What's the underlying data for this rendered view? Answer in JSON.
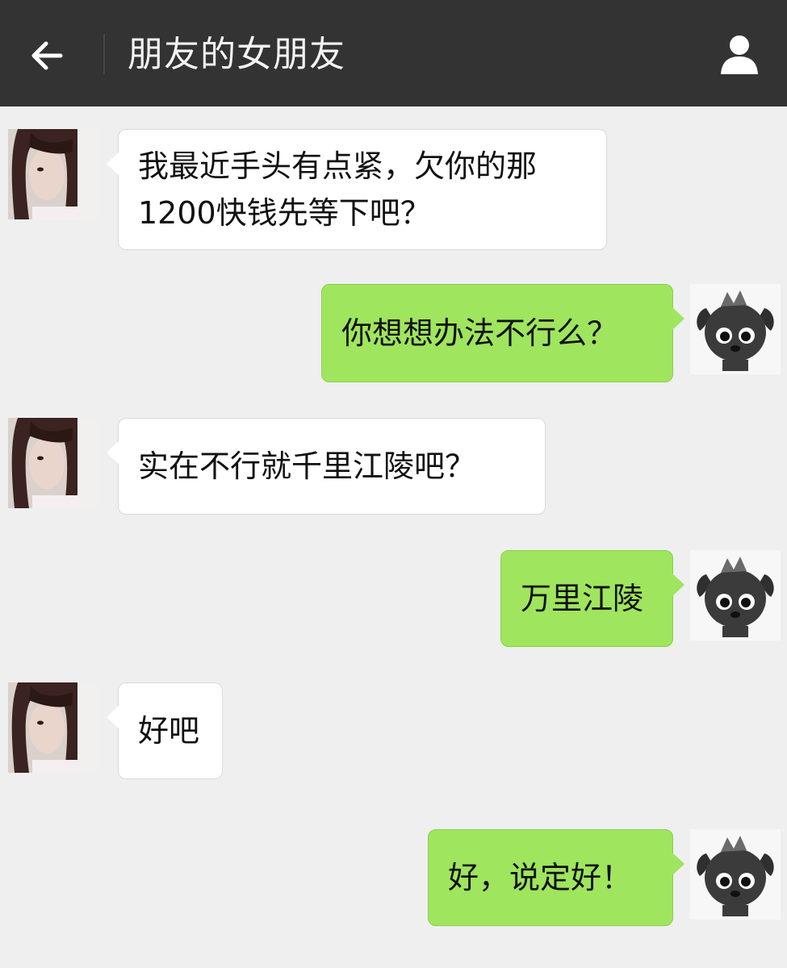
{
  "header": {
    "title": "朋友的女朋友",
    "back_icon": "arrow-left-icon",
    "contact_icon": "person-icon"
  },
  "colors": {
    "header_bg": "#333333",
    "chat_bg": "#efefef",
    "incoming_bubble": "#ffffff",
    "outgoing_bubble": "#9fe55e"
  },
  "messages": [
    {
      "sender": "friend",
      "text": "我最近手头有点紧，欠你的那1200快钱先等下吧？"
    },
    {
      "sender": "me",
      "text": "你想想办法不行么？"
    },
    {
      "sender": "friend",
      "text": "实在不行就千里江陵吧？"
    },
    {
      "sender": "me",
      "text": "万里江陵"
    },
    {
      "sender": "friend",
      "text": "好吧"
    },
    {
      "sender": "me",
      "text": "好，说定好！"
    }
  ]
}
